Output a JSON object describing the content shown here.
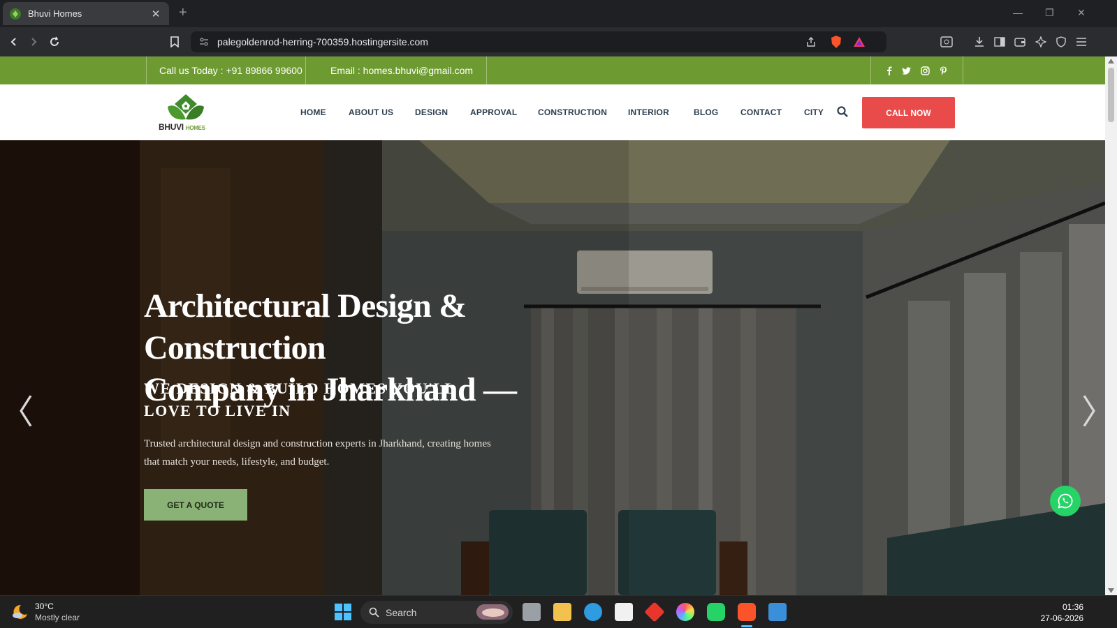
{
  "browser": {
    "tab_title": "Bhuvi Homes",
    "tab_close": "✕",
    "new_tab": "+",
    "url": "palegoldenrod-herring-700359.hostingersite.com",
    "window_controls": [
      "—",
      "❐",
      "✕"
    ]
  },
  "topbar": {
    "call": "Call us Today : +91 89866 99600",
    "email": "Email : homes.bhuvi@gmail.com",
    "social": [
      "facebook-icon",
      "twitter-icon",
      "instagram-icon",
      "pinterest-icon"
    ]
  },
  "logo": {
    "main": "BHUVI",
    "small": "HOMES"
  },
  "nav": {
    "items": [
      "HOME",
      "ABOUT US",
      "DESIGN",
      "APPROVAL",
      "CONSTRUCTION",
      "INTERIOR",
      "BLOG",
      "CONTACT",
      "CITY"
    ],
    "cta": "CALL NOW"
  },
  "hero": {
    "title_line1": "Architectural Design & Construction",
    "title_line2": "Company in Jharkhand —",
    "sub_line1": "WE DESIGN & BUILD HOMES YOU'LL",
    "sub_line2": "LOVE TO LIVE IN",
    "desc_line1": "Trusted architectural design and construction experts in Jharkhand, creating homes",
    "desc_line2": "that match your needs, lifestyle, and budget.",
    "button": "GET A QUOTE",
    "prev": "〈",
    "next": "〉"
  },
  "taskbar": {
    "weather_temp": "30°C",
    "weather_desc": "Mostly clear",
    "search_placeholder": "Search",
    "time": "01:36",
    "date": "27-06-2026"
  },
  "colors": {
    "topbar_green": "#6e9b31",
    "call_red": "#e94b4b",
    "quote_green": "#8bb276",
    "whatsapp": "#25d366"
  }
}
